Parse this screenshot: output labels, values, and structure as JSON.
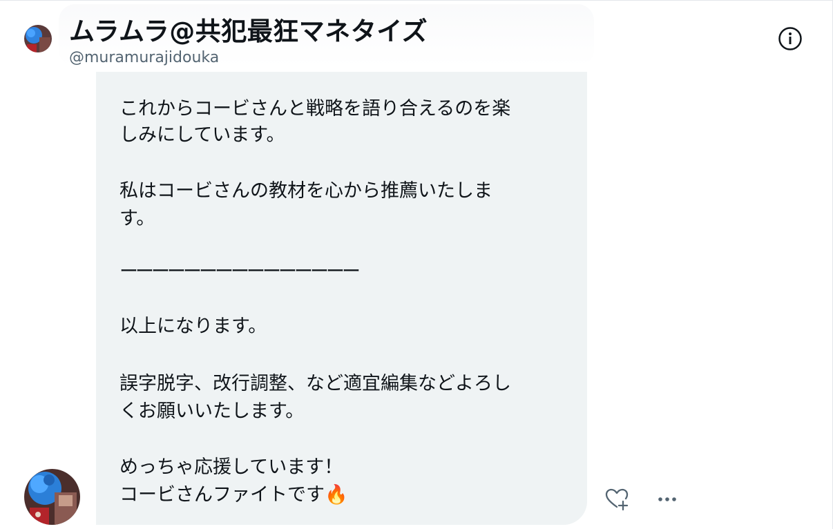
{
  "conversation": {
    "display_name": "ムラムラ@共犯最狂マネタイズ",
    "handle": "@muramurajidouka",
    "info_icon": "info-circle-icon"
  },
  "message": {
    "lines": [
      "これからコービさんと戦略を語り合えるのを楽",
      "しみにしています。",
      "私はコービさんの教材を心から推薦いたしま",
      "す。",
      "ーーーーーーーーーーーーーーー",
      "以上になります。",
      "誤字脱字、改行調整、など適宜編集などよろし",
      "くお願いいたします。",
      "めっちゃ応援しています！",
      "コービさんファイトです🔥"
    ],
    "actions": {
      "react_icon": "heart-plus-icon",
      "more_icon": "more-horizontal-icon"
    }
  },
  "colors": {
    "bubble_bg": "#eff3f4",
    "text": "#0f1419",
    "secondary_text": "#536471",
    "avatar_accent": "#2b7fd8"
  }
}
